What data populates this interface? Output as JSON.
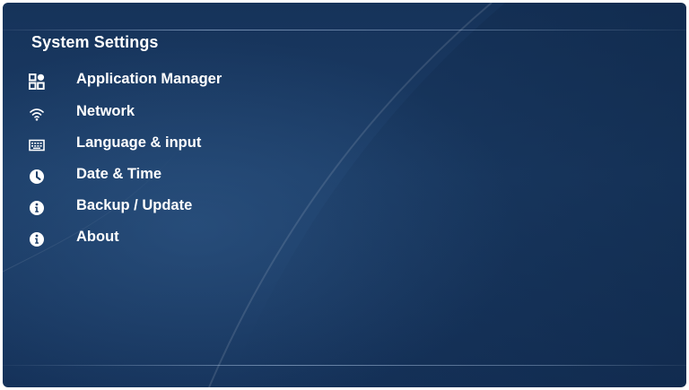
{
  "panel": {
    "title": "System Settings"
  },
  "menu": {
    "items": [
      {
        "label": "Application Manager",
        "icon": "app-grid-icon"
      },
      {
        "label": "Network",
        "icon": "wifi-icon"
      },
      {
        "label": "Language & input",
        "icon": "keyboard-icon"
      },
      {
        "label": "Date & Time",
        "icon": "clock-icon"
      },
      {
        "label": "Backup / Update",
        "icon": "info-icon"
      },
      {
        "label": "About",
        "icon": "info-icon"
      }
    ]
  },
  "colors": {
    "background": "#1b3c66",
    "text": "#ffffff"
  }
}
